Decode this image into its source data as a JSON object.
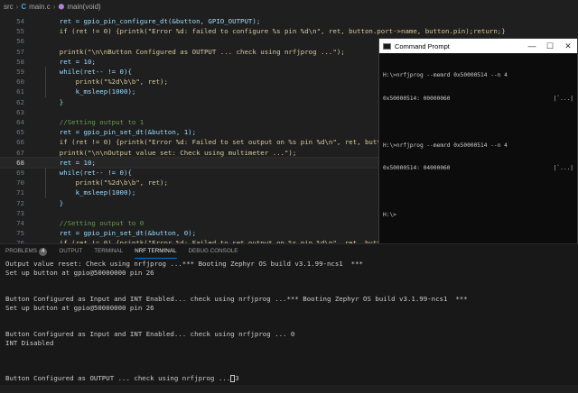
{
  "breadcrumb": {
    "folder": "src",
    "file": "main.c",
    "symbol": "main(void)"
  },
  "editor": {
    "current_line": 68,
    "lines": [
      {
        "num": "54",
        "text": "    ret = gpio_pin_configure_dt(&button, GPIO_OUTPUT);"
      },
      {
        "num": "55",
        "text": "    if (ret != 0) {printk(\"Error %d: failed to configure %s pin %d\\n\", ret, button.port->name, button.pin);return;}"
      },
      {
        "num": "56",
        "text": ""
      },
      {
        "num": "57",
        "text": "    printk(\"\\n\\nButton Configured as OUTPUT ... check using nrfjprog ...\");"
      },
      {
        "num": "58",
        "text": "    ret = 10;"
      },
      {
        "num": "59",
        "text": "    while(ret-- != 0){"
      },
      {
        "num": "60",
        "text": "        printk(\"%2d\\b\\b\", ret);"
      },
      {
        "num": "61",
        "text": "        k_msleep(1000);"
      },
      {
        "num": "62",
        "text": "    }"
      },
      {
        "num": "63",
        "text": ""
      },
      {
        "num": "64",
        "text": "    //Setting output to 1"
      },
      {
        "num": "65",
        "text": "    ret = gpio_pin_set_dt(&button, 1);"
      },
      {
        "num": "66",
        "text": "    if (ret != 0) {printk(\"Error %d: Failed to set output on %s pin %d\\n\", ret, button.port->"
      },
      {
        "num": "67",
        "text": "    printk(\"\\n\\nOutput value set: Check using multimeter ...\");"
      },
      {
        "num": "68",
        "text": "    ret = 10;"
      },
      {
        "num": "69",
        "text": "    while(ret-- != 0){"
      },
      {
        "num": "70",
        "text": "        printk(\"%2d\\b\\b\", ret);"
      },
      {
        "num": "71",
        "text": "        k_msleep(1000);"
      },
      {
        "num": "72",
        "text": "    }"
      },
      {
        "num": "73",
        "text": ""
      },
      {
        "num": "74",
        "text": "    //Setting output to 0"
      },
      {
        "num": "75",
        "text": "    ret = gpio_pin_set_dt(&button, 0);"
      },
      {
        "num": "76",
        "text": "    if (ret != 0) {printk(\"Error %d: Failed to set output on %s pin %d\\n\", ret, button.port->"
      },
      {
        "num": "77",
        "text": "    printk(\"\\n\\nOutput value reset: Check using multimeter ...\");"
      },
      {
        "num": "78",
        "text": "    ret = 10;"
      }
    ]
  },
  "cmd": {
    "title": "Command Prompt",
    "lines": [
      "H:\\>nrfjprog --memrd 0x50000514 --n 4",
      "0x50000514: 00000060",
      "",
      "H:\\>nrfjprog --memrd 0x50000514 --n 4",
      "0x50000514: 04000060",
      "",
      "H:\\>"
    ],
    "ascii": [
      "|`...|",
      "|`...|"
    ]
  },
  "panel": {
    "tabs": [
      "PROBLEMS",
      "OUTPUT",
      "TERMINAL",
      "NRF TERMINAL",
      "DEBUG CONSOLE"
    ],
    "problems_count": "4",
    "active_tab": "NRF TERMINAL",
    "terminal_lines": [
      "Output value reset: Check using nrfjprog ...*** Booting Zephyr OS build v3.1.99-ncs1  ***",
      "Set up button at gpio@50000000 pin 26",
      "",
      "",
      "Button Configured as Input and INT Enabled... check using nrfjprog ...*** Booting Zephyr OS build v3.1.99-ncs1  ***",
      "Set up button at gpio@50000000 pin 26",
      "",
      "",
      "Button Configured as Input and INT Enabled... check using nrfjprog ... 0",
      "INT Disabled",
      "",
      "",
      "",
      "Button Configured as OUTPUT ... check using nrfjprog ...",
      ""
    ],
    "terminal_tail": "3"
  }
}
